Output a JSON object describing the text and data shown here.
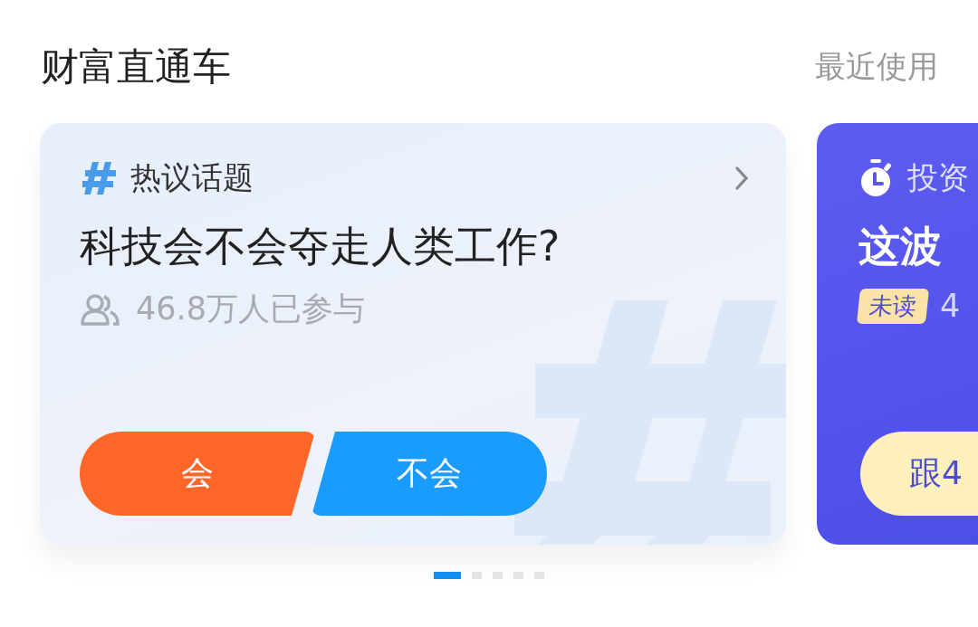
{
  "header": {
    "title": "财富直通车",
    "link": "最近使用"
  },
  "cards": [
    {
      "kind": "topic",
      "tag": "热议话题",
      "title": "科技会不会夺走人类工作?",
      "meta": "46.8万人已参与",
      "buttons": [
        {
          "label": "会",
          "kind": "yes"
        },
        {
          "label": "不会",
          "kind": "no"
        }
      ]
    },
    {
      "kind": "invest",
      "tag": "投资",
      "title": "这波",
      "badge": "未读",
      "meta": "4",
      "button": "跟4"
    }
  ],
  "pager": [
    {
      "selected": true
    },
    {
      "selected": false
    },
    {
      "selected": false
    },
    {
      "selected": false
    },
    {
      "selected": false
    }
  ]
}
